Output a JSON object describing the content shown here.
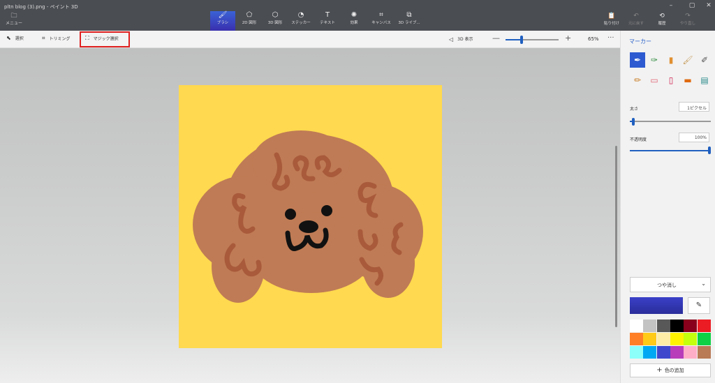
{
  "window": {
    "title": "pltn blog (3).png - ペイント 3D",
    "controls": [
      "–",
      "▢",
      "✕"
    ]
  },
  "ribbon": {
    "menu_label": "メニュー",
    "tools": [
      {
        "label": "ブラシ",
        "icon": "brush-icon",
        "glyph": "🖌",
        "active": true
      },
      {
        "label": "2D 図形",
        "icon": "2d-shapes-icon",
        "glyph": "⬠",
        "active": false
      },
      {
        "label": "3D 図形",
        "icon": "3d-shapes-icon",
        "glyph": "⬡",
        "active": false
      },
      {
        "label": "ステッカー",
        "icon": "stickers-icon",
        "glyph": "◔",
        "active": false
      },
      {
        "label": "テキスト",
        "icon": "text-icon",
        "glyph": "T",
        "active": false
      },
      {
        "label": "効果",
        "icon": "effects-icon",
        "glyph": "✺",
        "active": false
      },
      {
        "label": "キャンバス",
        "icon": "canvas-icon",
        "glyph": "⌗",
        "active": false
      },
      {
        "label": "3D ライブ...",
        "icon": "3d-library-icon",
        "glyph": "⧉",
        "active": false
      }
    ],
    "right_tools": [
      {
        "label": "貼り付け",
        "icon": "paste-icon",
        "glyph": "📋",
        "enabled": true
      },
      {
        "label": "元に戻す",
        "icon": "undo-icon",
        "glyph": "↶",
        "enabled": false
      },
      {
        "label": "履歴",
        "icon": "history-icon",
        "glyph": "🕘",
        "enabled": true
      },
      {
        "label": "やり直し",
        "icon": "redo-icon",
        "glyph": "↷",
        "enabled": false
      }
    ]
  },
  "subbar": {
    "select_label": "選択",
    "crop_label": "トリミング",
    "magic_select_label": "マジック選択",
    "view3d_label": "3D 表示",
    "zoom_level": "65%",
    "zoom_fraction": 0.3
  },
  "panel": {
    "title": "マーカー",
    "brushes_row1": [
      "marker-icon",
      "calligraphy-pen-icon",
      "oil-brush-icon",
      "watercolor-icon",
      "pixel-pen-icon"
    ],
    "brushes_row2": [
      "pencil-icon",
      "eraser-icon",
      "crayon-icon",
      "spray-can-icon",
      "fill-icon"
    ],
    "size_label": "太さ",
    "size_value": "1ピクセル",
    "size_fraction": 0.03,
    "opacity_label": "不透明度",
    "opacity_value": "100%",
    "opacity_fraction": 1.0,
    "finish_value": "つや消し",
    "current_color": "#3a40c8",
    "palette": [
      "#ffffff",
      "#c3c3c3",
      "#585858",
      "#000000",
      "#88001b",
      "#ec1c24",
      "#ff7f27",
      "#ffca18",
      "#fdeca6",
      "#fff200",
      "#c4ff0e",
      "#0ed145",
      "#8cfffb",
      "#00a8f3",
      "#3f48cc",
      "#b83dba",
      "#ffaec8",
      "#b97a56"
    ],
    "add_color_label": "色の追加"
  }
}
